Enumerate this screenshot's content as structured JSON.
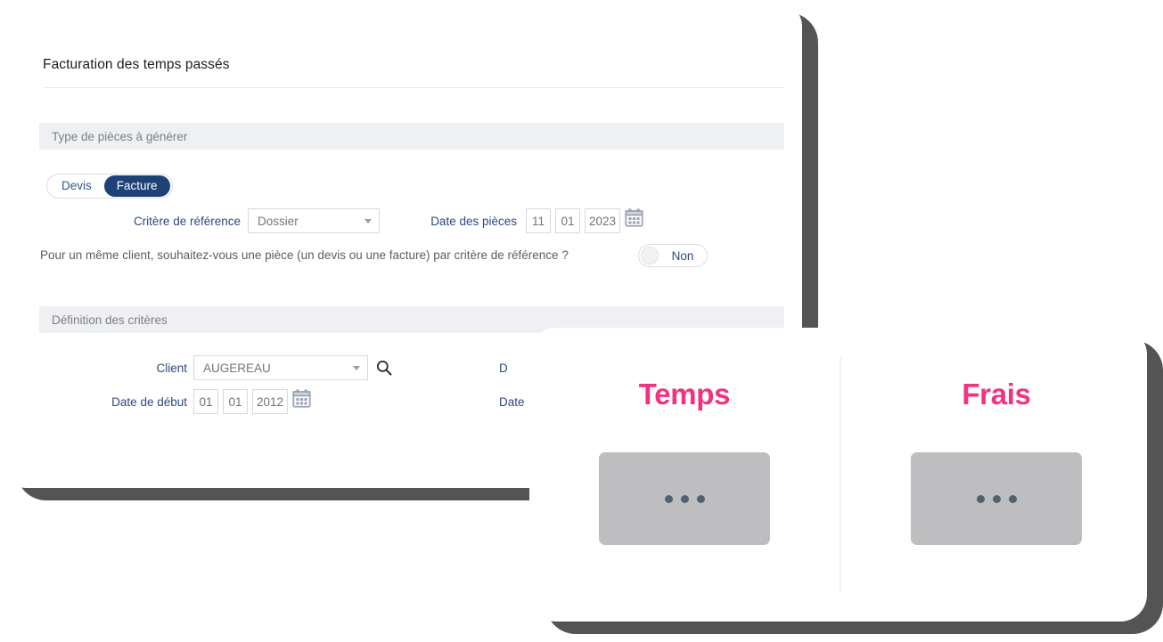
{
  "window": {
    "title": "Facturation des temps passés"
  },
  "sections": {
    "type_band": "Type de pièces à générer",
    "criteres_band": "Définition des critères"
  },
  "segmented": {
    "options": [
      {
        "label": "Devis",
        "active": false
      },
      {
        "label": "Facture",
        "active": true
      }
    ]
  },
  "form": {
    "critere_label": "Critère de référence",
    "critere_value": "Dossier",
    "date_pieces_label": "Date des pièces",
    "date_pieces": {
      "day": "11",
      "month": "01",
      "year": "2023"
    },
    "question": "Pour un même client, souhaitez-vous une pièce (un devis ou une facture) par critère de référence ?",
    "toggle_state": "Non",
    "client_label": "Client",
    "client_value": "AUGEREAU",
    "date_debut_label": "Date de début",
    "date_debut": {
      "day": "01",
      "month": "01",
      "year": "2012"
    },
    "right_label_top": "D",
    "right_label_bottom": "Date "
  },
  "overlay": {
    "panels": [
      {
        "title": "Temps"
      },
      {
        "title": "Frais"
      }
    ]
  },
  "colors": {
    "accent_pink": "#f2327f",
    "navy": "#1e4178",
    "label_blue": "#2d4a7c",
    "band_gray": "#eff0f4",
    "frame_dark": "#545454",
    "placeholder_gray": "#bebec0"
  },
  "icons": {
    "calendar": "calendar-icon",
    "search": "search-icon",
    "caret": "chevron-down-icon"
  }
}
